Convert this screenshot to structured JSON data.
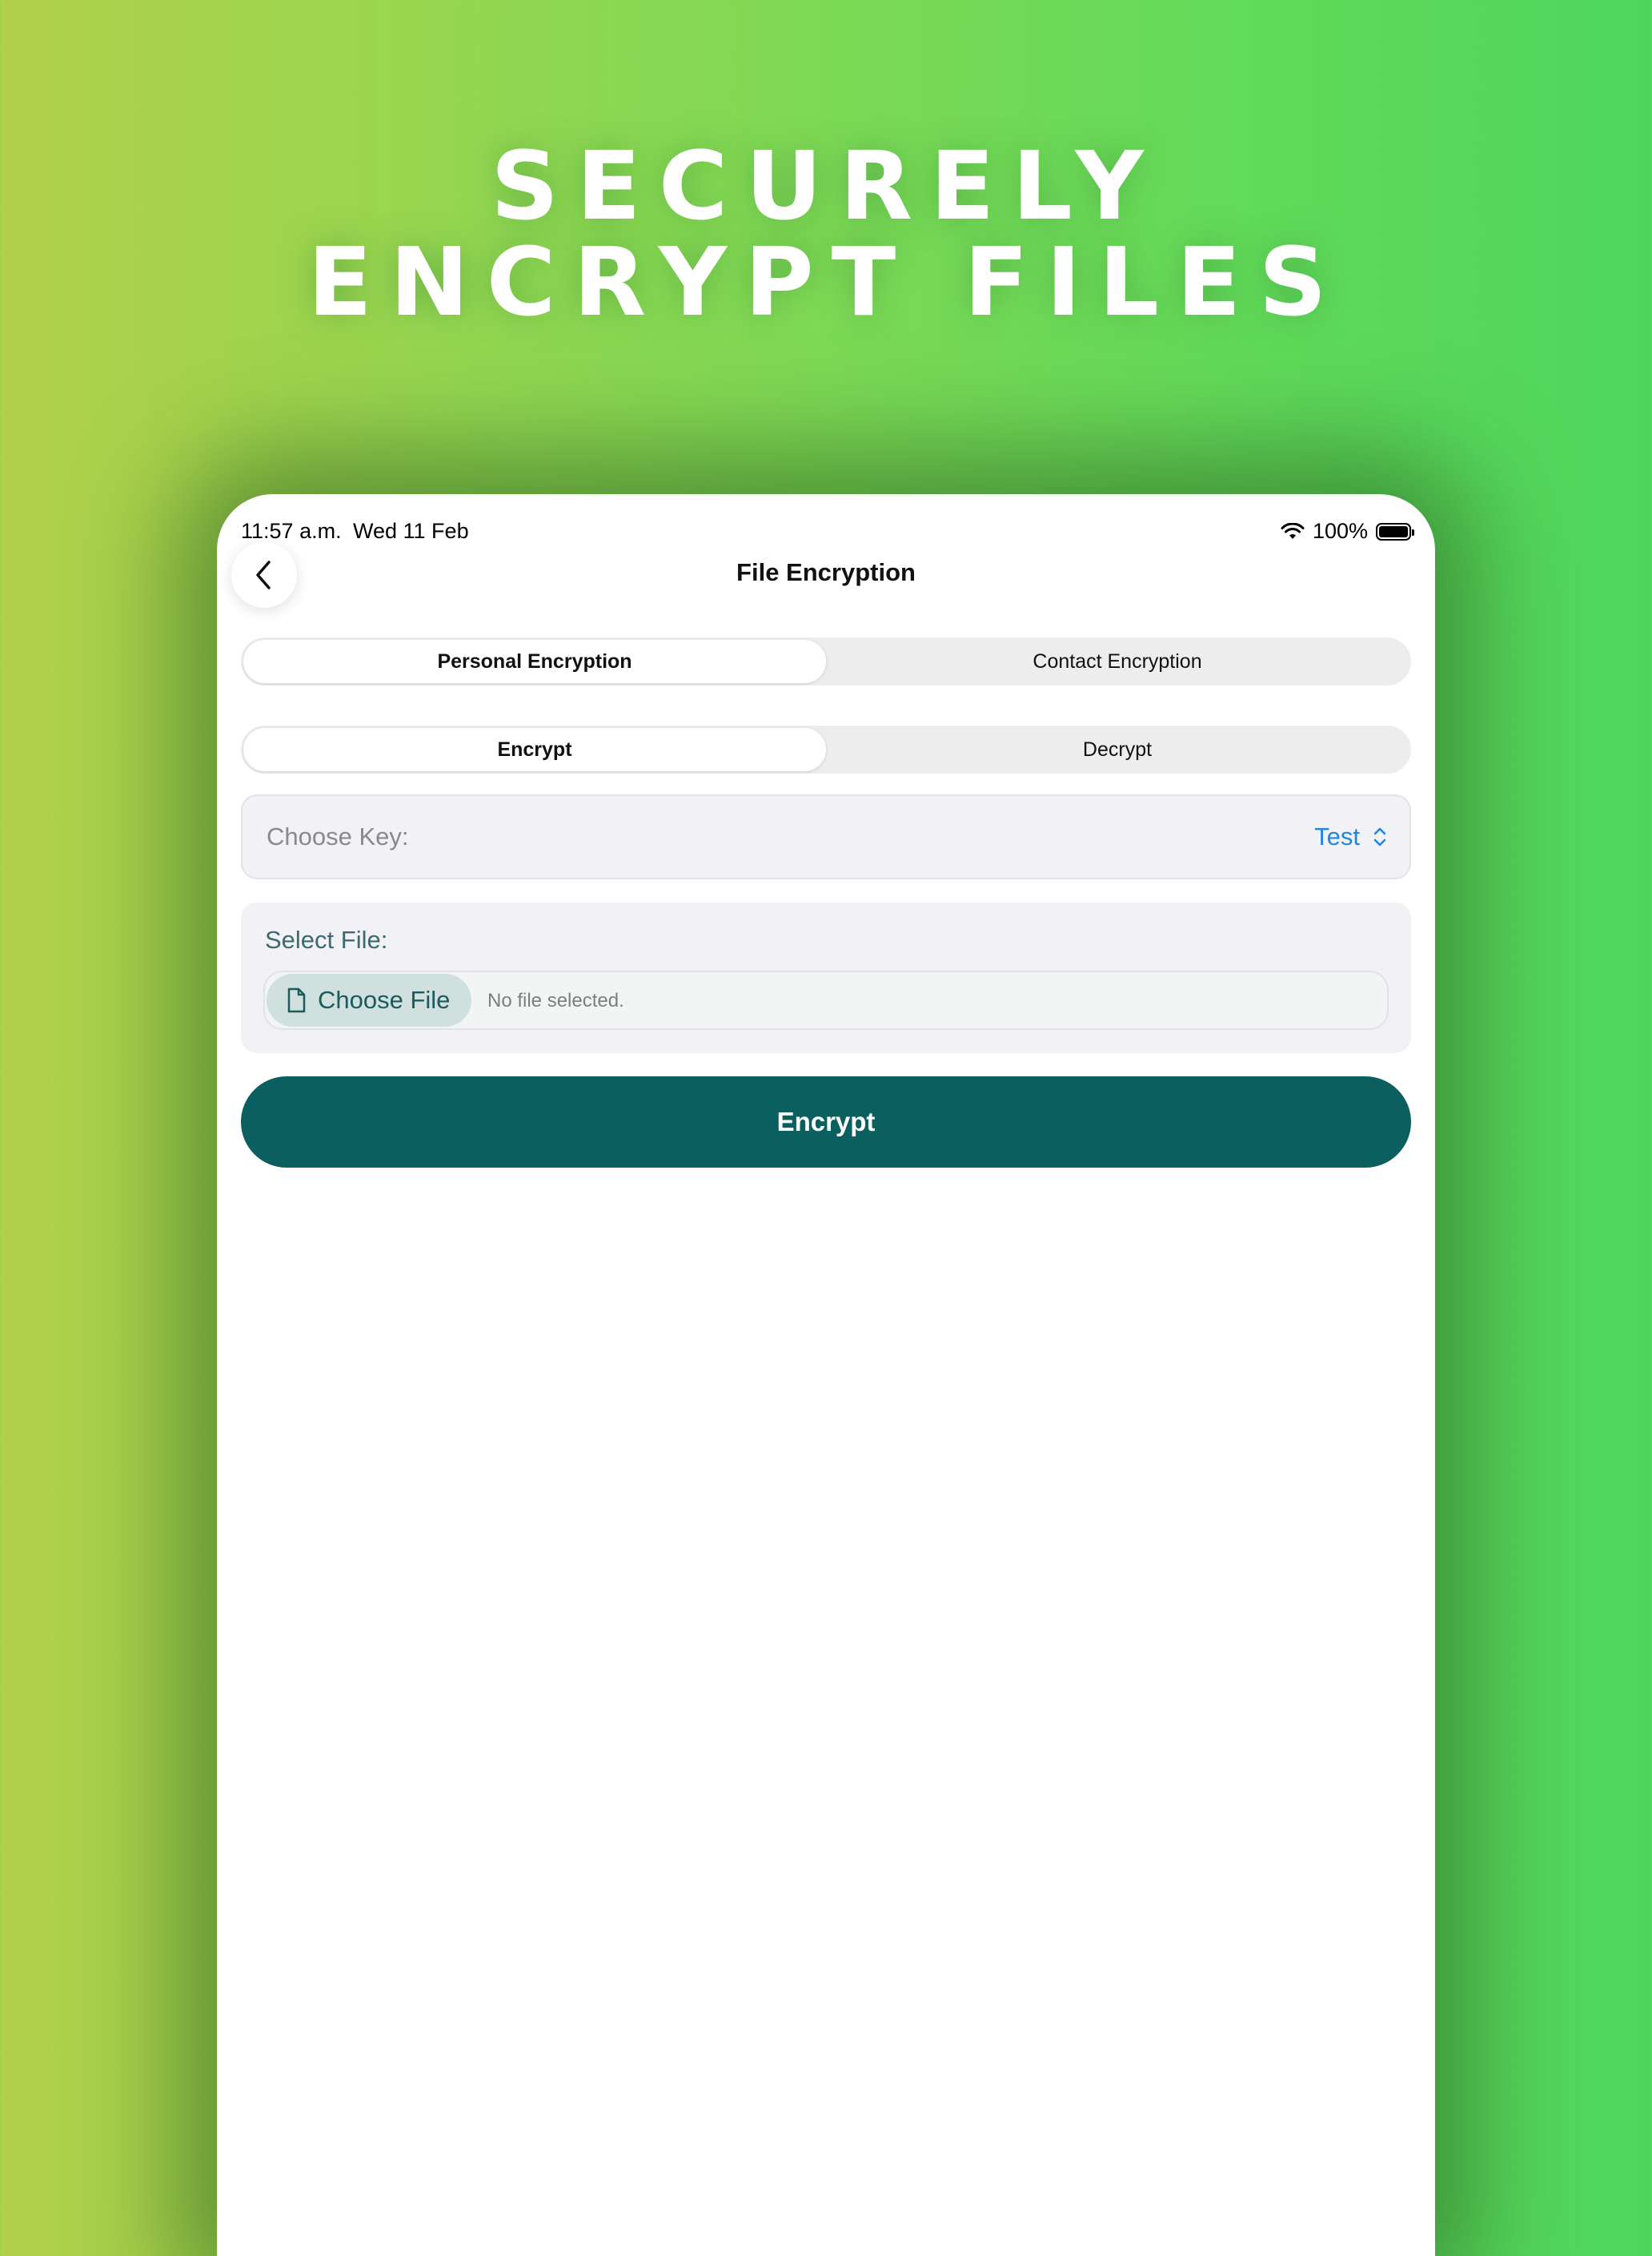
{
  "headline": {
    "line1": "SECURELY",
    "line2": "ENCRYPT FILES"
  },
  "status_bar": {
    "time": "11:57 a.m.",
    "date": "Wed 11 Feb",
    "battery": "100%"
  },
  "nav": {
    "title": "File Encryption"
  },
  "mode_tabs": [
    {
      "label": "Personal Encryption",
      "selected": true
    },
    {
      "label": "Contact Encryption",
      "selected": false
    }
  ],
  "action_tabs": [
    {
      "label": "Encrypt",
      "selected": true
    },
    {
      "label": "Decrypt",
      "selected": false
    }
  ],
  "key": {
    "label": "Choose Key:",
    "value": "Test"
  },
  "file": {
    "label": "Select File:",
    "button": "Choose File",
    "status": "No file selected."
  },
  "primary_button": "Encrypt",
  "colors": {
    "accent": "#0c5f5f",
    "link": "#1d86e6",
    "background_start": "#b2d04a",
    "background_end": "#4ed65c"
  }
}
